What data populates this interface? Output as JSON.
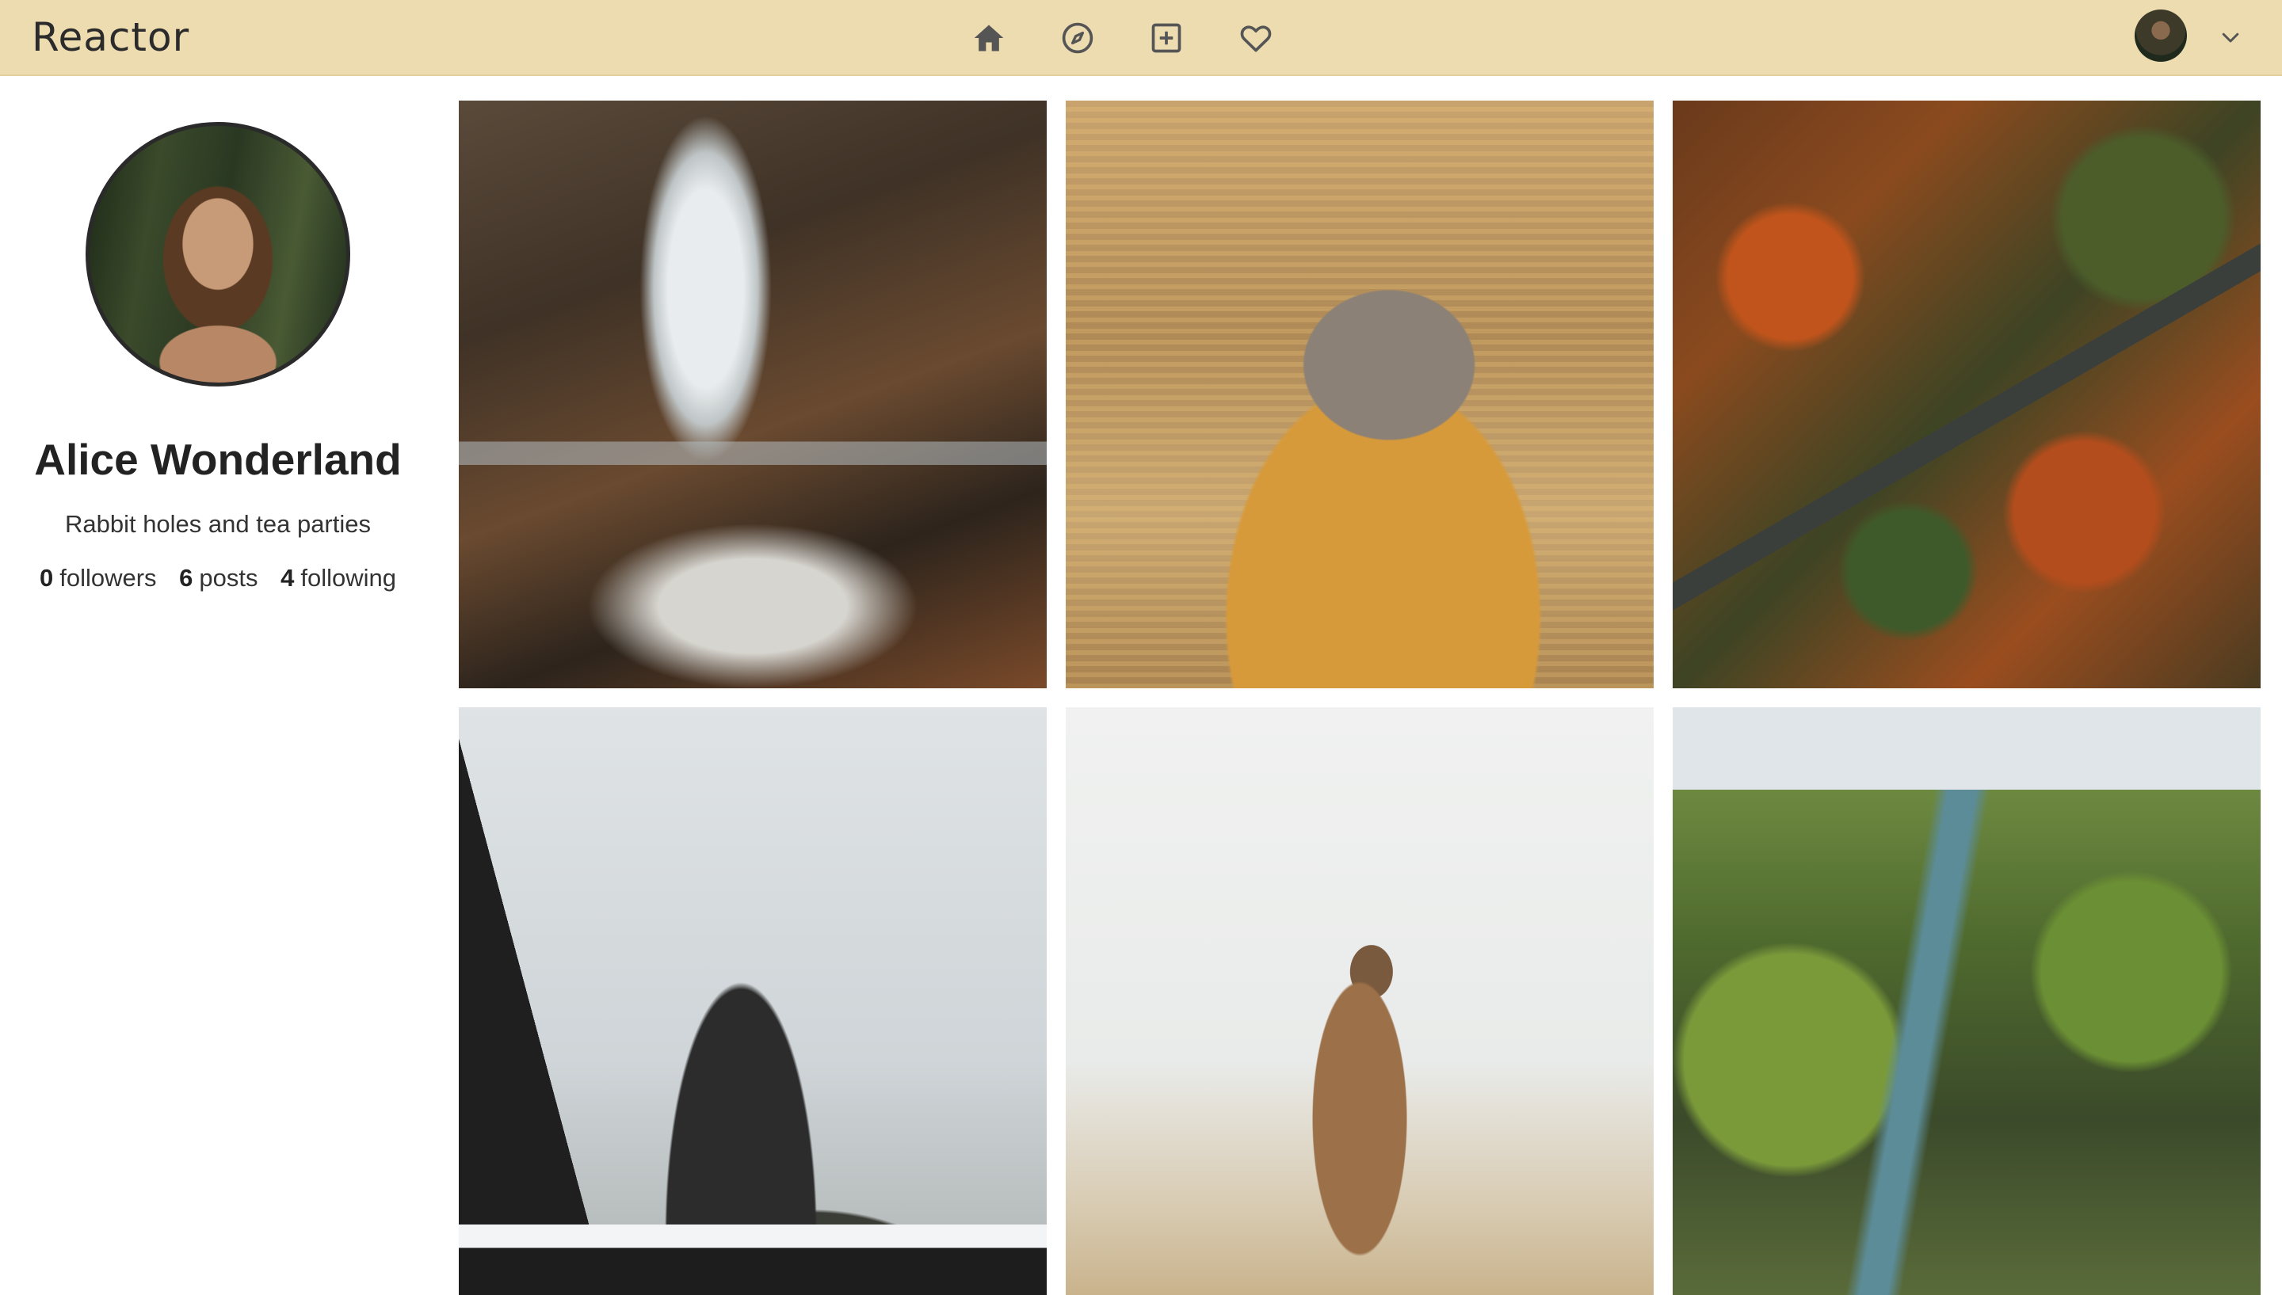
{
  "header": {
    "brand": "Reactor",
    "nav": [
      {
        "icon": "home-icon"
      },
      {
        "icon": "compass-icon"
      },
      {
        "icon": "plus-square-icon"
      },
      {
        "icon": "heart-icon"
      }
    ],
    "user_menu_icon": "chevron-down-icon"
  },
  "profile": {
    "name": "Alice Wonderland",
    "bio": "Rabbit holes and tea parties",
    "stats": {
      "followers_count": "0",
      "followers_label": "followers",
      "posts_count": "6",
      "posts_label": "posts",
      "following_count": "4",
      "following_label": "following"
    }
  },
  "colors": {
    "header_bg": "#ecdcb0",
    "page_bg": "#ffffff",
    "text": "#222222"
  }
}
